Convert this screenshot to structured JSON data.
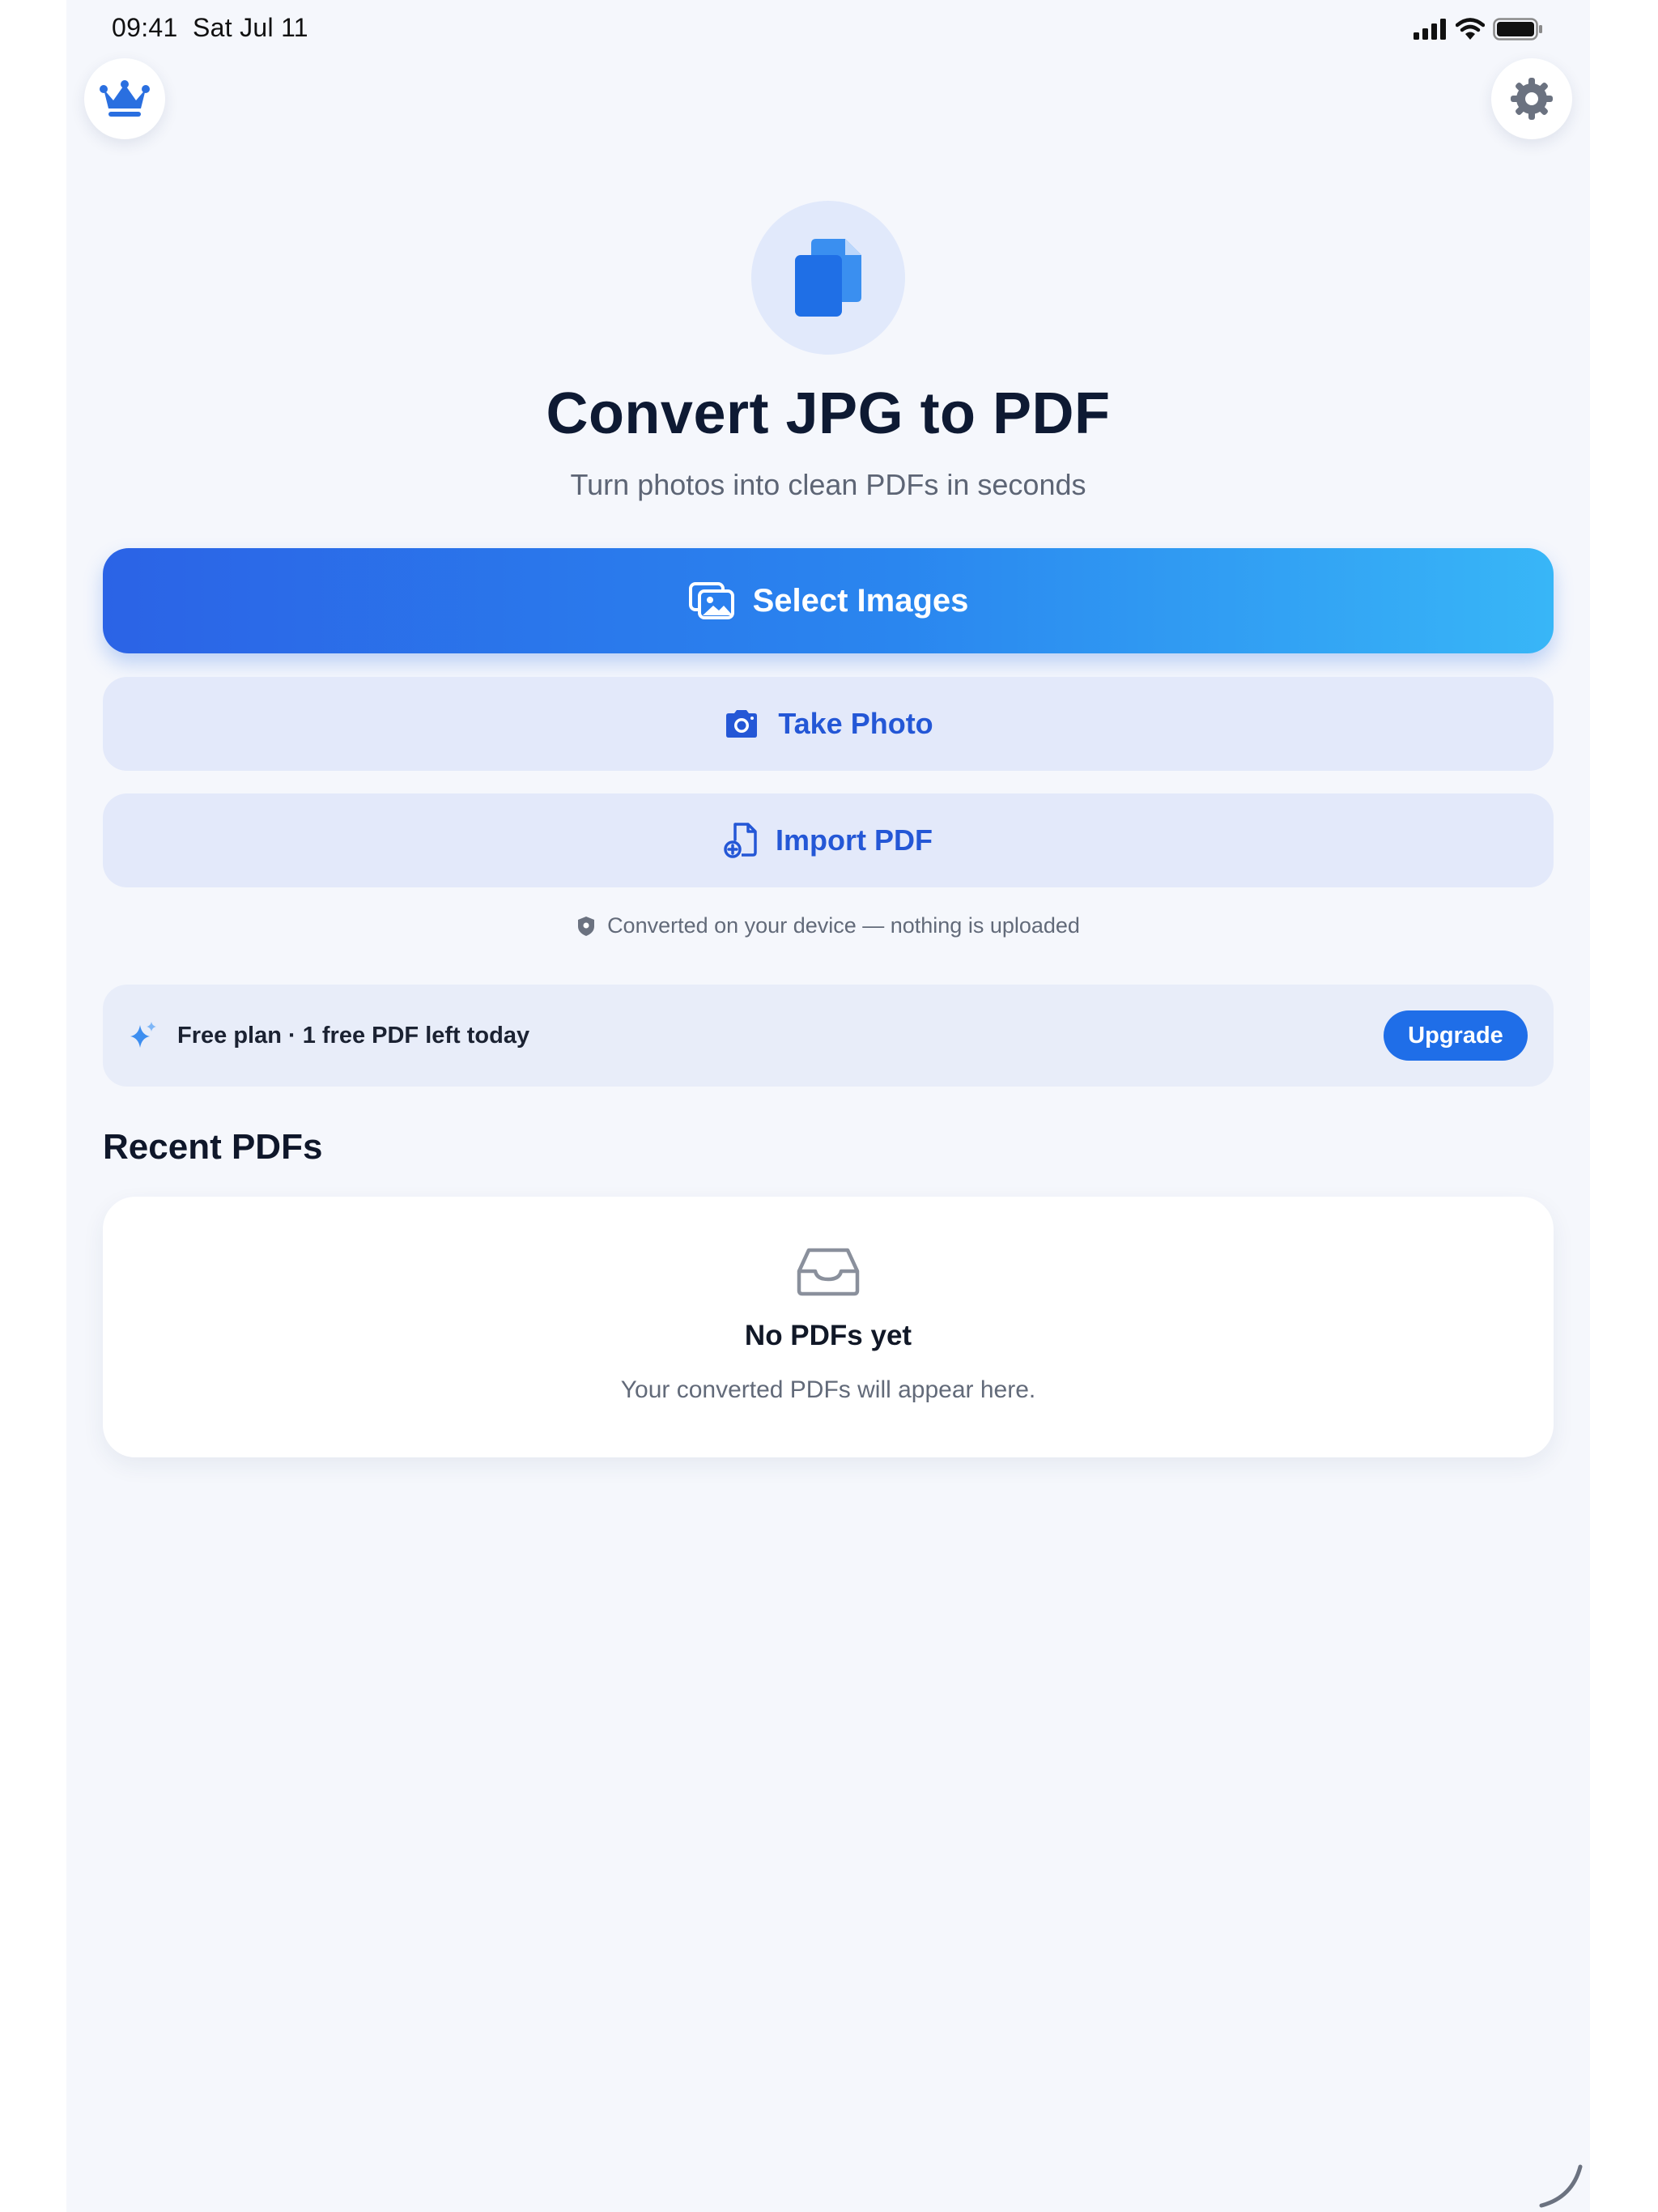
{
  "status_bar": {
    "time": "09:41",
    "date": "Sat Jul 11",
    "icons": [
      "cellular-signal-icon",
      "wifi-icon",
      "battery-icon"
    ]
  },
  "header": {
    "premium_icon": "crown-icon",
    "settings_icon": "gear-icon"
  },
  "hero": {
    "icon": "documents-icon",
    "title": "Convert JPG to PDF",
    "subtitle": "Turn photos into clean PDFs in seconds"
  },
  "actions": {
    "select_images": {
      "label": "Select Images",
      "icon": "photos-icon"
    },
    "take_photo": {
      "label": "Take Photo",
      "icon": "camera-icon"
    },
    "import_pdf": {
      "label": "Import PDF",
      "icon": "document-add-icon"
    }
  },
  "privacy": {
    "icon": "shield-icon",
    "text": "Converted on your device — nothing is uploaded"
  },
  "plan": {
    "icon": "sparkles-icon",
    "text": "Free plan · 1 free PDF left today",
    "upgrade_label": "Upgrade"
  },
  "recent": {
    "title": "Recent PDFs",
    "empty_icon": "tray-icon",
    "empty_title": "No PDFs yet",
    "empty_subtitle": "Your converted PDFs will appear here."
  },
  "colors": {
    "background": "#f5f7fc",
    "accent": "#2457d6",
    "gradient_start": "#2b63e6",
    "gradient_end": "#38b6f7",
    "secondary_button": "#e3e9fa"
  }
}
